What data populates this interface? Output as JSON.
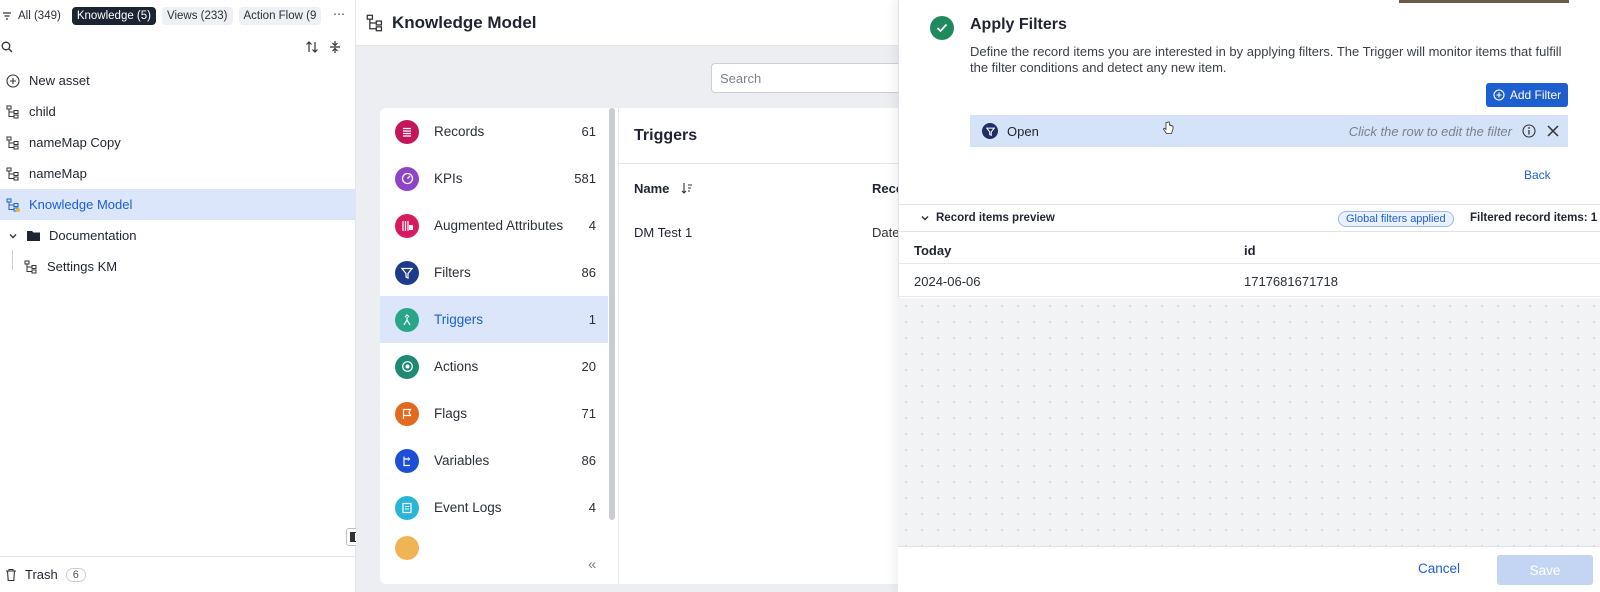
{
  "sidebar": {
    "tabs": [
      {
        "label": "All (349)"
      },
      {
        "label": "Knowledge (5)"
      },
      {
        "label": "Views (233)"
      },
      {
        "label": "Action Flow (9"
      }
    ],
    "tree": [
      {
        "label": "New asset",
        "icon": "plus-circle-icon"
      },
      {
        "label": "child",
        "icon": "knowledge-model-icon"
      },
      {
        "label": "nameMap Copy",
        "icon": "knowledge-model-icon"
      },
      {
        "label": "nameMap",
        "icon": "knowledge-model-icon"
      },
      {
        "label": "Knowledge Model",
        "icon": "knowledge-model-icon",
        "selected": true
      },
      {
        "label": "Documentation",
        "icon": "folder-icon",
        "expanded": true
      },
      {
        "label": "Settings KM",
        "icon": "knowledge-model-icon"
      }
    ],
    "trash": {
      "label": "Trash",
      "count": "6"
    }
  },
  "main": {
    "title": "Knowledge Model",
    "search_placeholder": "Search",
    "categories": [
      {
        "label": "Records",
        "count": "61",
        "icon": "records-icon",
        "color": "#c2185b"
      },
      {
        "label": "KPIs",
        "count": "581",
        "icon": "kpi-gauge-icon",
        "color": "#8e44c7"
      },
      {
        "label": "Augmented Attributes",
        "count": "4",
        "icon": "augmented-attributes-icon",
        "color": "#d81b60"
      },
      {
        "label": "Filters",
        "count": "86",
        "icon": "filter-icon",
        "color": "#1e3a8a"
      },
      {
        "label": "Triggers",
        "count": "1",
        "icon": "trigger-icon",
        "color": "#2aa58a",
        "selected": true
      },
      {
        "label": "Actions",
        "count": "20",
        "icon": "actions-icon",
        "color": "#1f8a72"
      },
      {
        "label": "Flags",
        "count": "71",
        "icon": "flag-icon",
        "color": "#e2691f"
      },
      {
        "label": "Variables",
        "count": "86",
        "icon": "variables-icon",
        "color": "#1d4ed8"
      },
      {
        "label": "Event Logs",
        "count": "4",
        "icon": "event-logs-icon",
        "color": "#29b6d6"
      }
    ],
    "triggers": {
      "title": "Triggers",
      "columns": [
        "Name",
        "Reco"
      ],
      "rows": [
        {
          "name": "DM Test 1",
          "record": "Date"
        }
      ]
    }
  },
  "drawer": {
    "title": "Apply Filters",
    "description": "Define the record items you are interested in by applying filters. The Trigger will monitor items that fulfill the filter conditions and detect any new item.",
    "add_filter_label": "Add Filter",
    "filter": {
      "name": "Open",
      "hint": "Click the row to edit the filter"
    },
    "back_label": "Back",
    "preview": {
      "label": "Record items preview",
      "global_badge": "Global filters applied",
      "filtered_count": "Filtered record items: 1",
      "columns": [
        "Today",
        "id"
      ],
      "rows": [
        {
          "today": "2024-06-06",
          "id": "1717681671718"
        }
      ]
    },
    "cancel_label": "Cancel",
    "save_label": "Save"
  },
  "colors": {
    "accent": "#1d5fd1",
    "selection": "#dbe6fb",
    "success": "#1f8a5b"
  }
}
